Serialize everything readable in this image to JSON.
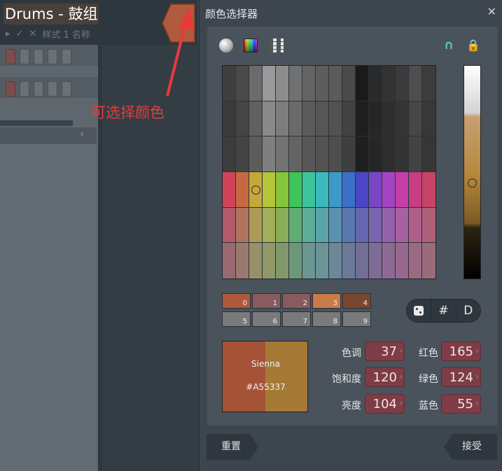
{
  "channel_rack": {
    "title": "Drums - 鼓组",
    "subbar": {
      "arrow": "▸",
      "check": "✓",
      "cross": "✕",
      "label": "样式 1 名称"
    },
    "tab_color": "#b05a3e",
    "footer_chevron": "›"
  },
  "annotation": {
    "text": "可选择颜色",
    "color": "#e83a3a"
  },
  "dialog": {
    "title": "颜色选择器",
    "close_icon": "close-icon",
    "toolbar_icons": [
      "sphere-icon",
      "spectrum-icon",
      "grid-palette-icon",
      "magnet-icon",
      "lock-icon"
    ],
    "palette": {
      "rows": [
        [
          "#3f3f3f",
          "#4a4a4a",
          "#6b6b6b",
          "#9a9a9a",
          "#8c8c8c",
          "#717171",
          "#646464",
          "#5d5d5d",
          "#5b5b5b",
          "#4a4a4a",
          "#1a1a1a",
          "#2a2a2a",
          "#333333",
          "#3b3b3b",
          "#4e4e4e",
          "#3c3c3c"
        ],
        [
          "#3a3a3a",
          "#454545",
          "#606060",
          "#8a8a8a",
          "#7d7d7d",
          "#6a6a6a",
          "#5b5b5b",
          "#565656",
          "#525252",
          "#424242",
          "#1e1e1e",
          "#262626",
          "#2e2e2e",
          "#353535",
          "#474747",
          "#383838"
        ],
        [
          "#3c3c3c",
          "#444444",
          "#5c5c5c",
          "#7f7f7f",
          "#737373",
          "#646464",
          "#575757",
          "#525252",
          "#4e4e4e",
          "#3f3f3f",
          "#1f1f1f",
          "#262626",
          "#2d2d2d",
          "#333333",
          "#434343",
          "#363636"
        ],
        [
          "#d0445a",
          "#c56a40",
          "#c3a83a",
          "#b5c53a",
          "#86c43a",
          "#3ec45a",
          "#3cc49c",
          "#3cb8c0",
          "#3c9ac8",
          "#3c70c8",
          "#4a46c4",
          "#7a46c4",
          "#a444c0",
          "#c43ea8",
          "#c83e82",
          "#c84466"
        ],
        [
          "#b05a6a",
          "#b0745e",
          "#ae9a58",
          "#a2ae58",
          "#88ae5a",
          "#5eae70",
          "#5cae98",
          "#5ca4ac",
          "#5a90b0",
          "#5a78b0",
          "#6466ae",
          "#7a64ae",
          "#9262aa",
          "#aa60a0",
          "#b05e8a",
          "#b0607a"
        ],
        [
          "#9a6a74",
          "#9a7a6e",
          "#98906a",
          "#90986a",
          "#82986c",
          "#6c987a",
          "#6a9890",
          "#6a9498",
          "#6a8898",
          "#6a7a98",
          "#726e96",
          "#7e6c96",
          "#8c6a94",
          "#986890",
          "#9a6a84",
          "#9a6c7a"
        ]
      ],
      "selected": {
        "row": 3,
        "col": 2
      }
    },
    "shade": {
      "position": 0.55
    },
    "recent_swatches": [
      {
        "label": "0",
        "color": "#b0583a"
      },
      {
        "label": "1",
        "color": "#8a5a5e"
      },
      {
        "label": "2",
        "color": "#8a5a5e"
      },
      {
        "label": "3",
        "color": "#c97b48"
      },
      {
        "label": "4",
        "color": "#7a4630"
      },
      {
        "label": "5",
        "color": "#7a7a7a"
      },
      {
        "label": "6",
        "color": "#7a7a7a"
      },
      {
        "label": "7",
        "color": "#7a7a7a"
      },
      {
        "label": "8",
        "color": "#7a7a7a"
      },
      {
        "label": "9",
        "color": "#7a7a7a"
      }
    ],
    "buttons": {
      "random_icon": "dice-icon",
      "hex": "#",
      "default": "D"
    },
    "preview": {
      "name": "Sienna",
      "hex": "#A55337",
      "current_color": "#a55337",
      "original_color": "#a57a37"
    },
    "fields": {
      "hue_label": "色调",
      "hue": "37",
      "saturation_label": "饱和度",
      "saturation": "120",
      "brightness_label": "亮度",
      "brightness": "104",
      "red_label": "红色",
      "red": "165",
      "green_label": "绿色",
      "green": "124",
      "blue_label": "蓝色",
      "blue": "55"
    },
    "reset_label": "重置",
    "accept_label": "接受"
  }
}
